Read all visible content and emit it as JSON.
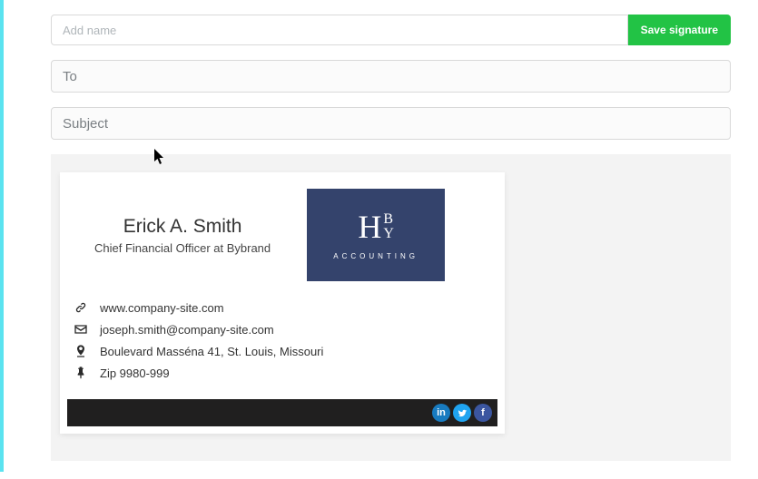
{
  "header": {
    "name_placeholder": "Add name",
    "save_label": "Save signature"
  },
  "fields": {
    "to_placeholder": "To",
    "subject_placeholder": "Subject"
  },
  "signature": {
    "person_name": "Erick A. Smith",
    "person_title": "Chief Financial Officer at Bybrand",
    "logo_text": "ACCOUNTING",
    "website": "www.company-site.com",
    "email": "joseph.smith@company-site.com",
    "address": "Boulevard Masséna 41, St. Louis, Missouri",
    "zip": "Zip 9980-999",
    "social": {
      "linkedin": "in",
      "twitter": "",
      "facebook": "f"
    }
  }
}
